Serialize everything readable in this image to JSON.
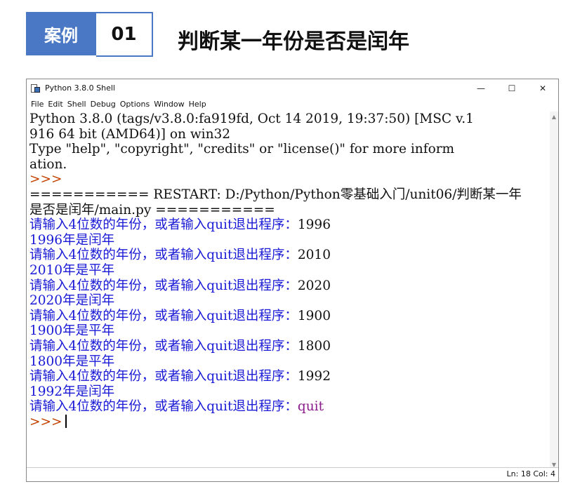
{
  "header": {
    "case_tag": "案例",
    "case_number": "01",
    "title": "判断某一年份是否是闰年"
  },
  "window": {
    "title": "Python 3.8.0 Shell",
    "controls": {
      "minimize": "—",
      "maximize": "☐",
      "close": "✕"
    },
    "menu": [
      "File",
      "Edit",
      "Shell",
      "Debug",
      "Options",
      "Window",
      "Help"
    ]
  },
  "shell": {
    "banner": [
      "Python 3.8.0 (tags/v3.8.0:fa919fd, Oct 14 2019, 19:37:50) [MSC v.1",
      "916 64 bit (AMD64)] on win32",
      "Type \"help\", \"copyright\", \"credits\" or \"license()\" for more inform",
      "ation."
    ],
    "prompt": ">>>",
    "restart": [
      "=========== RESTART: D:/Python/Python零基础入门/unit06/判断某一年",
      "是否是闰年/main.py ==========="
    ],
    "input_prompt": "请输入4位数的年份，或者输入quit退出程序：",
    "runs": [
      {
        "input": "1996",
        "output": "1996年是闰年"
      },
      {
        "input": "2010",
        "output": "2010年是平年"
      },
      {
        "input": "2020",
        "output": "2020年是闰年"
      },
      {
        "input": "1900",
        "output": "1900年是平年"
      },
      {
        "input": "1800",
        "output": "1800年是平年"
      },
      {
        "input": "1992",
        "output": "1992年是闰年"
      }
    ],
    "final_input": "quit",
    "final_prompt": ">>>"
  },
  "status": {
    "text": "Ln: 18  Col: 4"
  },
  "colors": {
    "accent": "#4a78c4",
    "prompt": "#c44000",
    "stdout": "#1a1ad6",
    "user_input": "#8a1a8a"
  }
}
